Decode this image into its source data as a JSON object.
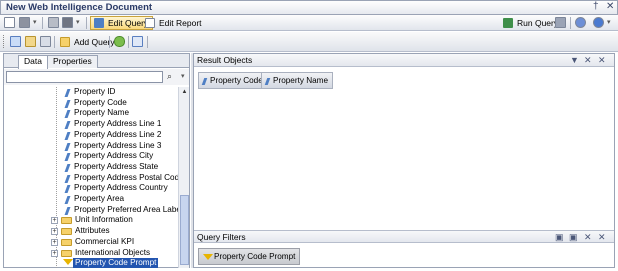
{
  "window": {
    "title": "New Web Intelligence Document",
    "controls": [
      "†",
      "✕"
    ]
  },
  "toolbar1": {
    "edit_query": "Edit Query",
    "edit_report": "Edit Report",
    "run_query": "Run Query"
  },
  "toolbar2": {
    "add_query": "Add Query"
  },
  "left_panel": {
    "tabs": [
      "Data",
      "Properties"
    ],
    "tree": [
      {
        "label": "Property ID",
        "kind": "object"
      },
      {
        "label": "Property Code",
        "kind": "object"
      },
      {
        "label": "Property Name",
        "kind": "object"
      },
      {
        "label": "Property Address Line 1",
        "kind": "object"
      },
      {
        "label": "Property Address Line 2",
        "kind": "object"
      },
      {
        "label": "Property Address Line 3",
        "kind": "object"
      },
      {
        "label": "Property Address City",
        "kind": "object"
      },
      {
        "label": "Property Address State",
        "kind": "object"
      },
      {
        "label": "Property Address Postal Code",
        "kind": "object"
      },
      {
        "label": "Property Address Country",
        "kind": "object"
      },
      {
        "label": "Property Area",
        "kind": "object"
      },
      {
        "label": "Property Preferred Area Label",
        "kind": "object"
      },
      {
        "label": "Unit Information",
        "kind": "folder"
      },
      {
        "label": "Attributes",
        "kind": "folder"
      },
      {
        "label": "Commercial KPI",
        "kind": "folder"
      },
      {
        "label": "International Objects",
        "kind": "folder"
      },
      {
        "label": "Property Code Prompt",
        "kind": "filter",
        "selected": true
      }
    ]
  },
  "result_objects": {
    "title": "Result Objects",
    "chips": [
      "Property Code",
      "Property Name"
    ]
  },
  "query_filters": {
    "title": "Query Filters",
    "chips": [
      "Property Code Prompt"
    ]
  }
}
